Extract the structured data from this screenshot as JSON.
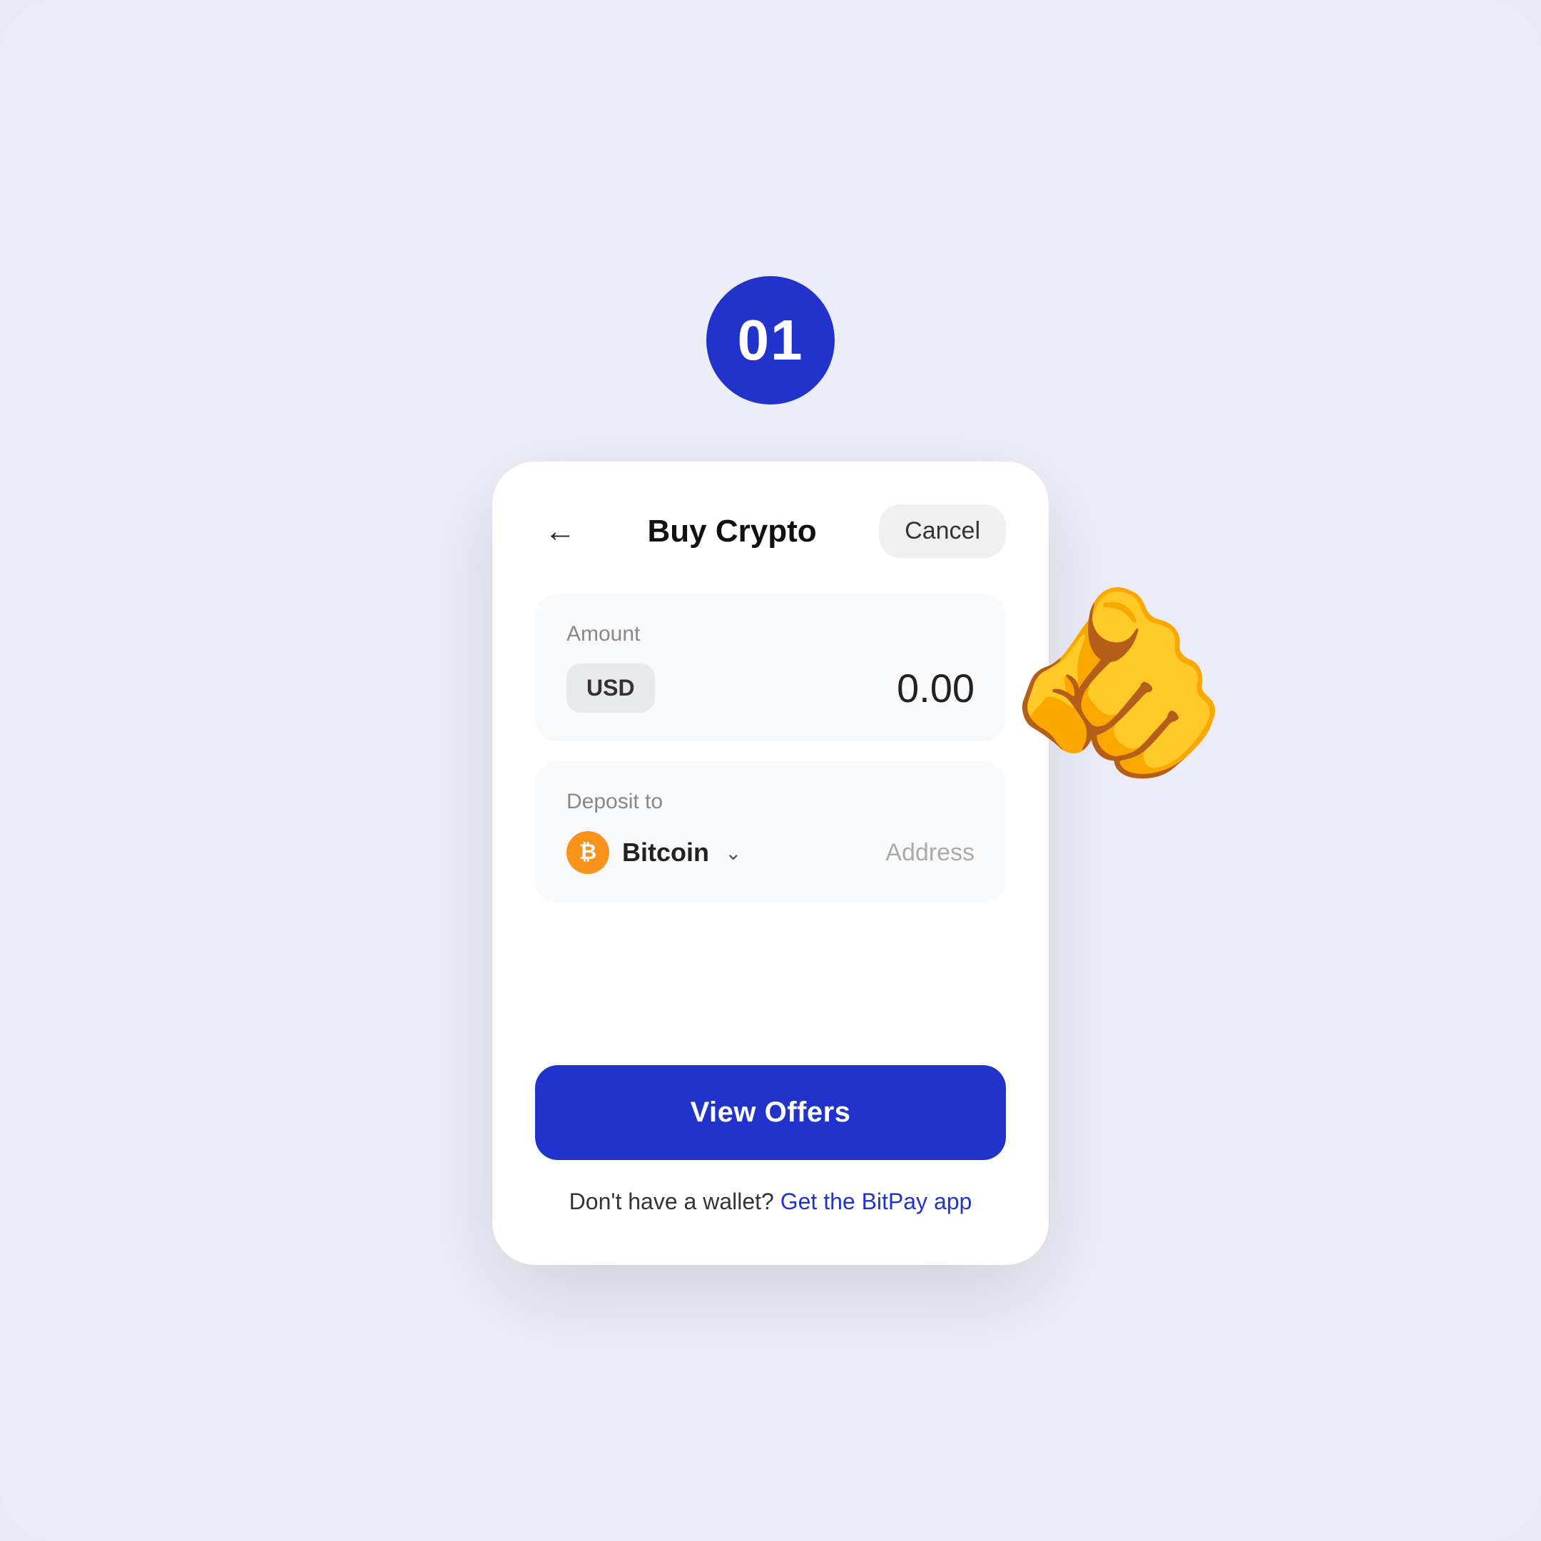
{
  "step": {
    "badge": "01"
  },
  "header": {
    "title": "Buy Crypto",
    "cancel_label": "Cancel",
    "back_aria": "back"
  },
  "amount_section": {
    "label": "Amount",
    "currency": "USD",
    "value": "0.00"
  },
  "deposit_section": {
    "label": "Deposit to",
    "crypto_name": "Bitcoin",
    "address_label": "Address"
  },
  "cta": {
    "view_offers_label": "View Offers"
  },
  "footer": {
    "text": "Don't have a wallet?",
    "link_text": "Get the BitPay app"
  }
}
